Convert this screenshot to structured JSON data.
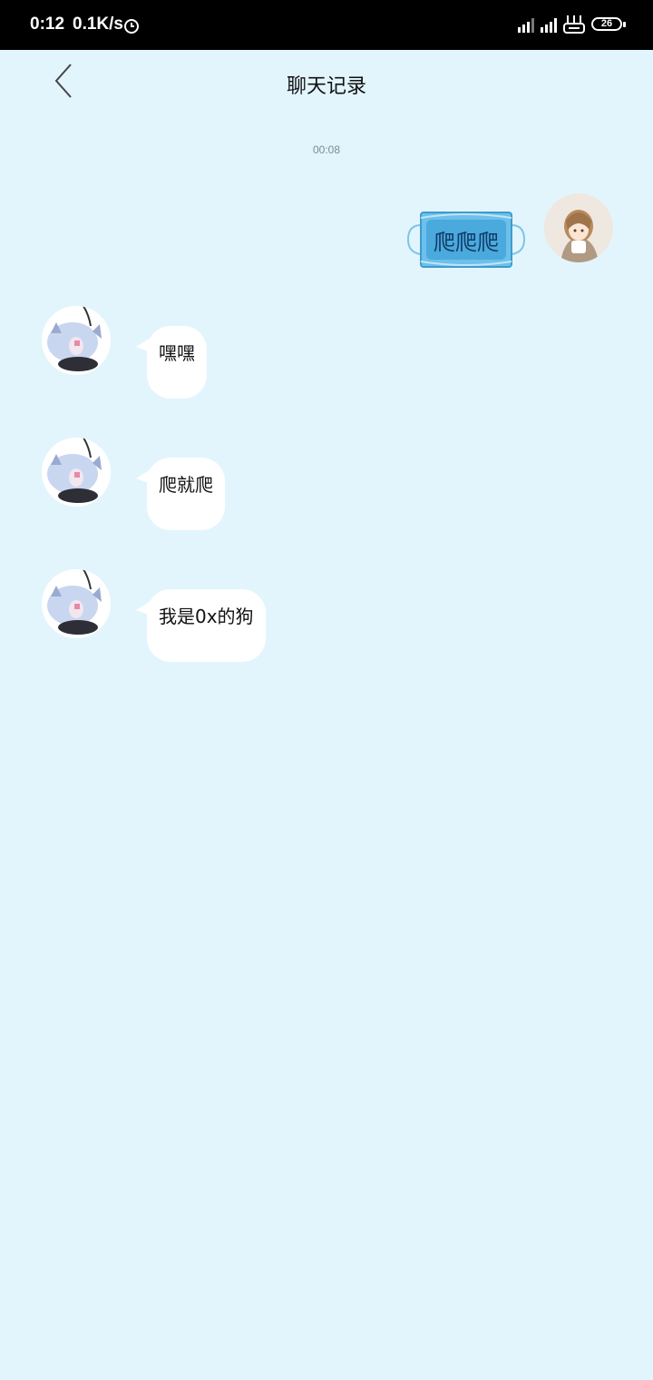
{
  "status_bar": {
    "time": "0:12",
    "net_speed": "0.1K/s",
    "battery_level": "26",
    "icons": [
      "clock-icon",
      "signal-icon",
      "signal-icon",
      "router-icon",
      "battery-icon"
    ]
  },
  "header": {
    "title": "聊天记录",
    "back_icon": "chevron-left-icon"
  },
  "chat": {
    "timestamp": "00:08",
    "sent_sticker_text": "爬爬爬",
    "messages": [
      {
        "text": "嘿嘿"
      },
      {
        "text": "爬就爬"
      },
      {
        "text": "我是0x的狗"
      }
    ]
  },
  "colors": {
    "background": "#e2f5fd",
    "bubble": "#ffffff",
    "sticker_blue": "#5fb8e6"
  }
}
